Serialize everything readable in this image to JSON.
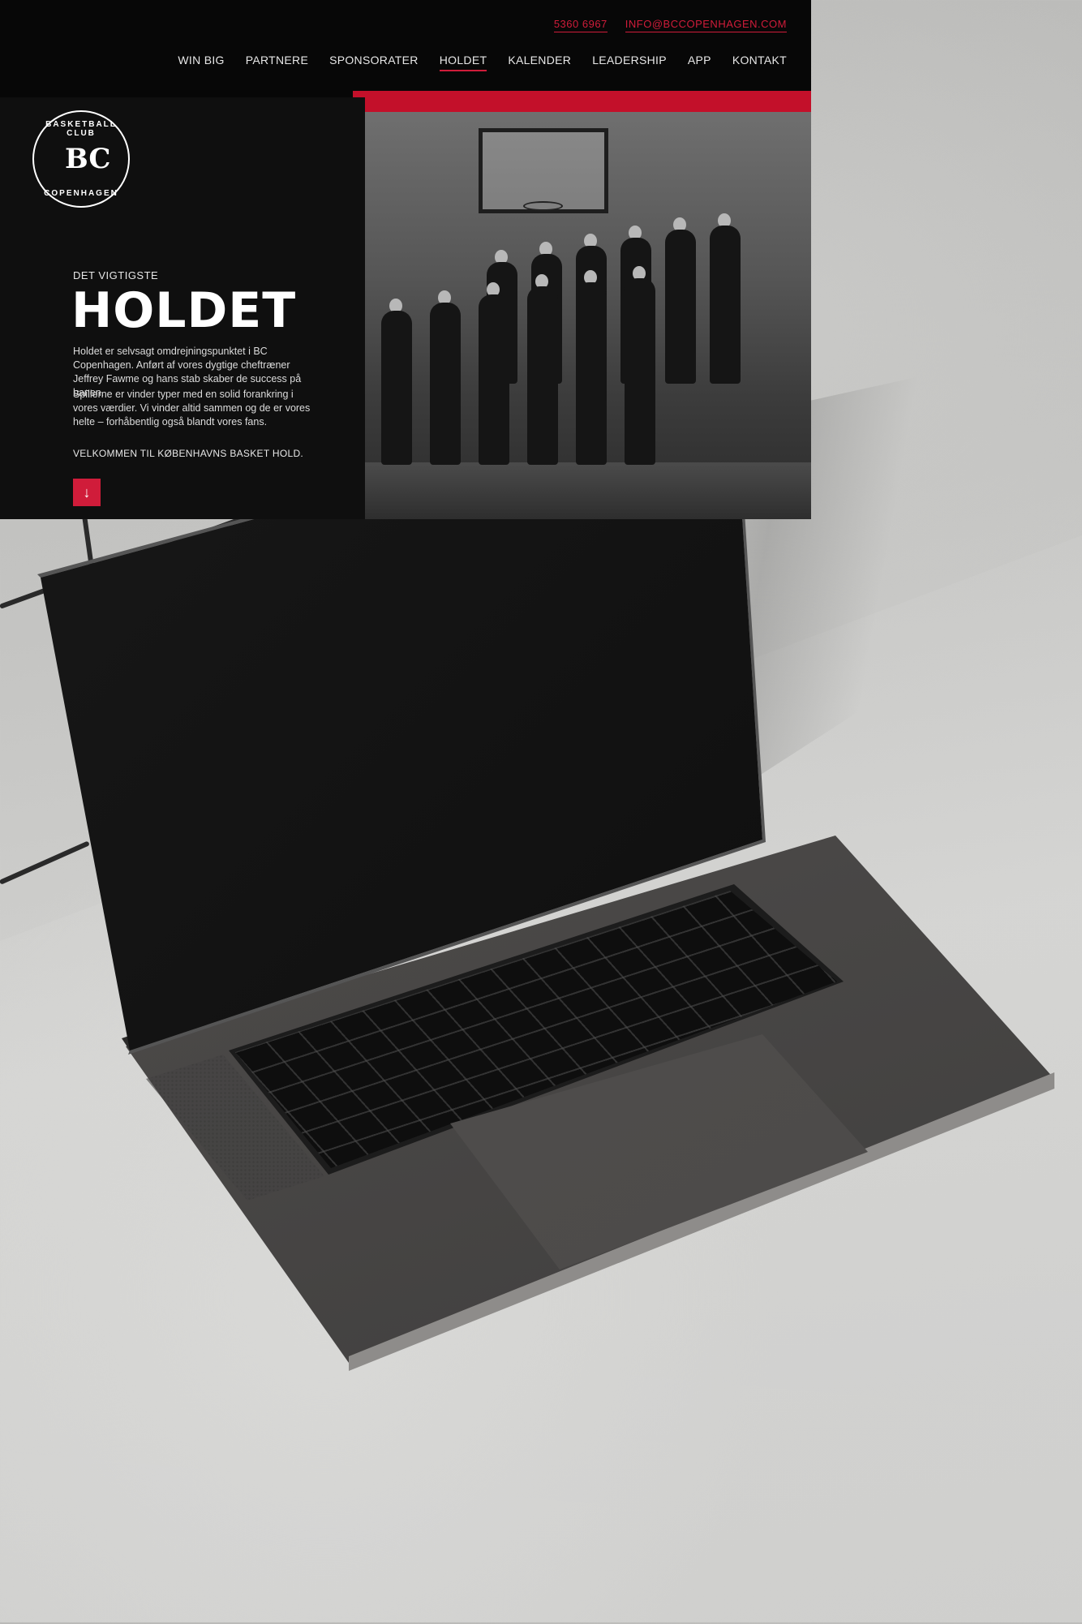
{
  "site": {
    "contact": {
      "phone": "5360 6967",
      "email": "INFO@BCCOPENHAGEN.COM"
    },
    "nav": [
      {
        "label": "WIN BIG"
      },
      {
        "label": "PARTNERE"
      },
      {
        "label": "SPONSORATER"
      },
      {
        "label": "HOLDET",
        "active": true
      },
      {
        "label": "KALENDER"
      },
      {
        "label": "LEADERSHIP"
      },
      {
        "label": "APP"
      },
      {
        "label": "KONTAKT"
      }
    ],
    "logo": {
      "top_text": "BASKETBALL CLUB",
      "bottom_text": "COPENHAGEN",
      "monogram": "BC"
    },
    "hero": {
      "eyebrow": "DET VIGTIGSTE",
      "title": "HOLDET",
      "paragraph_1": "Holdet er selvsagt omdrejningspunktet i BC Copenhagen. Anført af vores dygtige cheftræner Jeffrey Fawme og hans stab skaber de success på banen.",
      "paragraph_2": "Spillerne er vinder typer med en solid forankring i vores værdier. Vi vinder altid sammen og de er vores helte – forhåbentlig også blandt vores fans.",
      "welcome": "VELKOMMEN TIL KØBENHAVNS BASKET HOLD.",
      "scroll_button_icon": "arrow-down-icon"
    },
    "colors": {
      "accent": "#d01c3a",
      "background": "#0f0f0f"
    }
  }
}
